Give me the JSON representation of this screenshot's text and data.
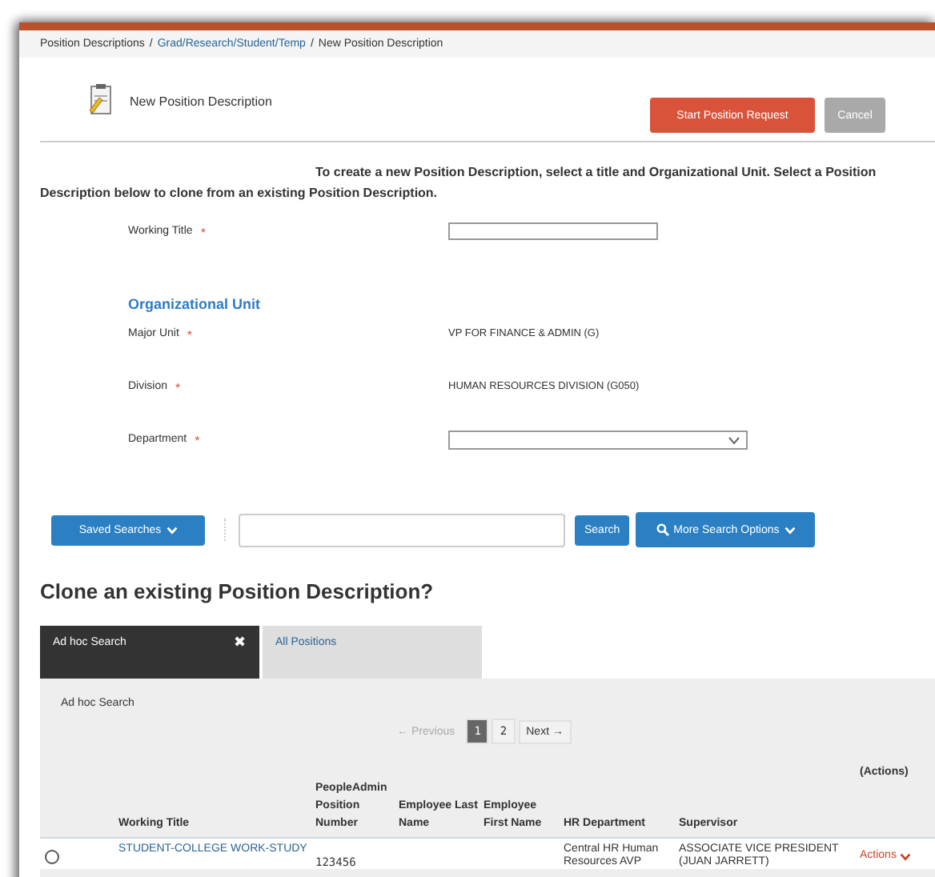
{
  "breadcrumb": [
    {
      "text": "Position Descriptions",
      "link": false
    },
    {
      "text": "Grad/Research/Student/Temp",
      "link": true
    },
    {
      "text": "New Position Description",
      "link": false
    }
  ],
  "breadcrumb_separator": "/",
  "header": {
    "title": "New Position Description",
    "buttons": [
      {
        "label": "Start Position Request",
        "kind": "primary"
      },
      {
        "label": "Cancel",
        "kind": "disabled"
      }
    ]
  },
  "intro": "To create a new Position Description, select a title and Organizational Unit. Select a Position Description below to clone from an existing Position Description.",
  "form": [
    {
      "label": "Working Title",
      "required": true,
      "kind": "input"
    },
    {
      "label": "Organizational Unit",
      "kind": "heading"
    },
    {
      "label": "Major Unit",
      "required": true,
      "kind": "text",
      "value": "VP FOR FINANCE & ADMIN (G)"
    },
    {
      "label": "Division",
      "required": true,
      "kind": "text",
      "value": "HUMAN RESOURCES DIVISION (G050)"
    },
    {
      "label": "Department",
      "required": true,
      "kind": "select"
    }
  ],
  "required_mark": "*",
  "search": {
    "saved_searches": "Saved Searches",
    "search_button": "Search",
    "more_options": "More Search Options"
  },
  "clone_heading": "Clone an existing Position Description?",
  "tabs": [
    {
      "label": "Ad hoc Search",
      "selected": true,
      "closable": true
    },
    {
      "label": "All Positions",
      "selected": false,
      "closable": false
    }
  ],
  "close_glyph": "✖",
  "panel_title": "Ad hoc Search",
  "pagination": {
    "previous": "← Previous",
    "next": "Next →",
    "pages": [
      {
        "label": "1",
        "selected": true
      },
      {
        "label": "2",
        "selected": false
      }
    ]
  },
  "table": {
    "actions_heading": "(Actions)",
    "columns": [
      "Working Title",
      "PeopleAdmin Position Number",
      "Employee Last Name",
      "Employee First Name",
      "HR Department",
      "Supervisor"
    ],
    "rows": [
      {
        "selected": false,
        "working_title": "STUDENT-COLLEGE WORK-STUDY",
        "position_number": "123456",
        "last_name": "",
        "first_name": "",
        "hr_department": "Central HR Human Resources AVP",
        "supervisor": "ASSOCIATE VICE PRESIDENT (JUAN JARRETT)",
        "actions": "Actions"
      }
    ]
  }
}
